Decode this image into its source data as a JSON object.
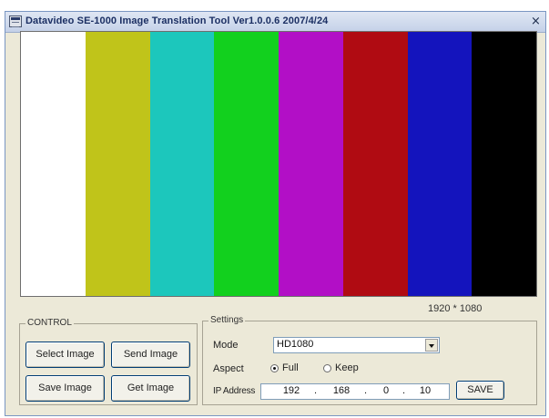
{
  "window": {
    "title": "Datavideo SE-1000 Image Translation Tool Ver1.0.0.6 2007/4/24",
    "close_glyph": "×"
  },
  "preview": {
    "resolution": "1920 * 1080",
    "bars": [
      {
        "name": "white",
        "color": "#ffffff"
      },
      {
        "name": "yellow",
        "color": "#c0c41a"
      },
      {
        "name": "cyan",
        "color": "#1cc7bc"
      },
      {
        "name": "green",
        "color": "#12d01e"
      },
      {
        "name": "magenta",
        "color": "#b20fc6"
      },
      {
        "name": "red",
        "color": "#b00b12"
      },
      {
        "name": "blue",
        "color": "#1414bd"
      },
      {
        "name": "black",
        "color": "#000000"
      }
    ]
  },
  "control": {
    "group_label": "CONTROL",
    "select_image": "Select Image",
    "send_image": "Send Image",
    "save_image": "Save Image",
    "get_image": "Get Image"
  },
  "settings": {
    "group_label": "Settings",
    "mode_label": "Mode",
    "mode_value": "HD1080",
    "aspect_label": "Aspect",
    "aspect_options": [
      {
        "label": "Full",
        "checked": true
      },
      {
        "label": "Keep",
        "checked": false
      }
    ],
    "ip_label": "IP Address",
    "ip_parts": [
      "192",
      "168",
      "0",
      "10"
    ],
    "ip_separator": ".",
    "save_label": "SAVE"
  },
  "icons": {
    "app": "app-icon",
    "close": "close-icon",
    "dropdown": "chevron-down-icon"
  }
}
